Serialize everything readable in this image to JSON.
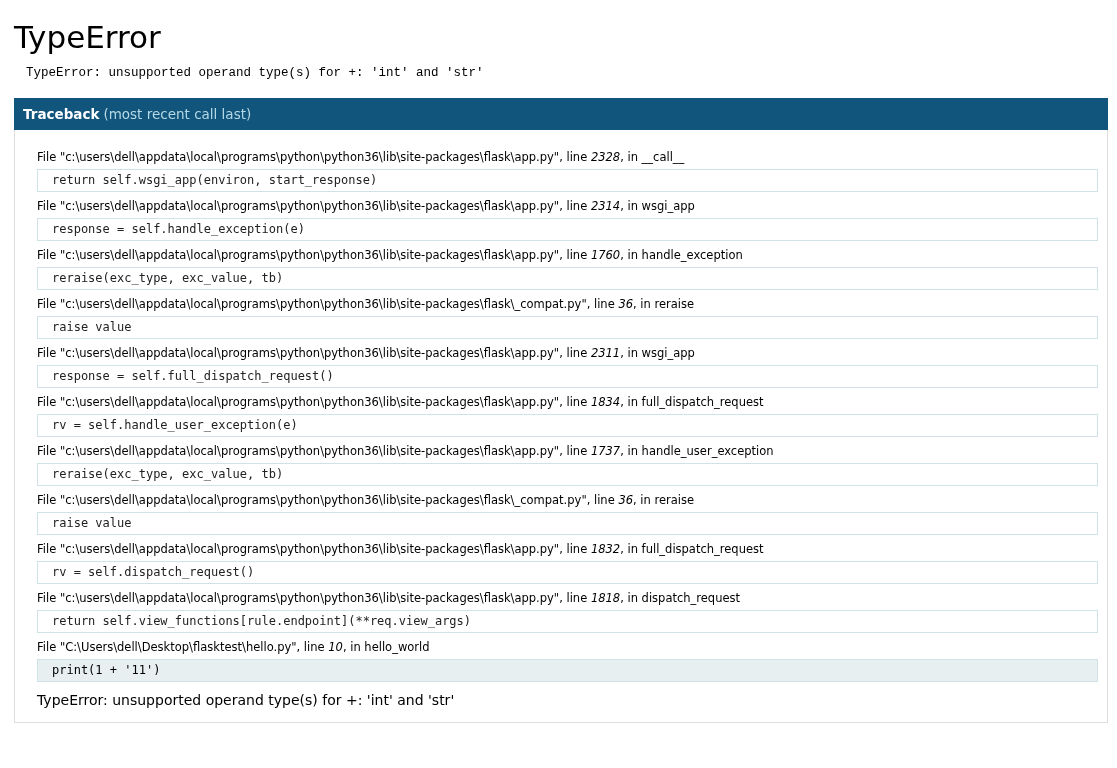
{
  "title": "TypeError",
  "error_summary": "TypeError: unsupported operand type(s) for +: 'int' and 'str'",
  "traceback": {
    "heading": "Traceback",
    "note": "(most recent call last)",
    "frames": [
      {
        "header": "File \"c:\\users\\dell\\appdata\\local\\programs\\python\\python36\\lib\\site-packages\\flask\\app.py\", line *2328*, in __call__",
        "code": "return self.wsgi_app(environ, start_response)",
        "current": false
      },
      {
        "header": "File \"c:\\users\\dell\\appdata\\local\\programs\\python\\python36\\lib\\site-packages\\flask\\app.py\", line *2314*, in wsgi_app",
        "code": "response = self.handle_exception(e)",
        "current": false
      },
      {
        "header": "File \"c:\\users\\dell\\appdata\\local\\programs\\python\\python36\\lib\\site-packages\\flask\\app.py\", line *1760*, in handle_exception",
        "code": "reraise(exc_type, exc_value, tb)",
        "current": false
      },
      {
        "header": "File \"c:\\users\\dell\\appdata\\local\\programs\\python\\python36\\lib\\site-packages\\flask\\_compat.py\", line *36*, in reraise",
        "code": "raise value",
        "current": false
      },
      {
        "header": "File \"c:\\users\\dell\\appdata\\local\\programs\\python\\python36\\lib\\site-packages\\flask\\app.py\", line *2311*, in wsgi_app",
        "code": "response = self.full_dispatch_request()",
        "current": false
      },
      {
        "header": "File \"c:\\users\\dell\\appdata\\local\\programs\\python\\python36\\lib\\site-packages\\flask\\app.py\", line *1834*, in full_dispatch_request",
        "code": "rv = self.handle_user_exception(e)",
        "current": false
      },
      {
        "header": "File \"c:\\users\\dell\\appdata\\local\\programs\\python\\python36\\lib\\site-packages\\flask\\app.py\", line *1737*, in handle_user_exception",
        "code": "reraise(exc_type, exc_value, tb)",
        "current": false
      },
      {
        "header": "File \"c:\\users\\dell\\appdata\\local\\programs\\python\\python36\\lib\\site-packages\\flask\\_compat.py\", line *36*, in reraise",
        "code": "raise value",
        "current": false
      },
      {
        "header": "File \"c:\\users\\dell\\appdata\\local\\programs\\python\\python36\\lib\\site-packages\\flask\\app.py\", line *1832*, in full_dispatch_request",
        "code": "rv = self.dispatch_request()",
        "current": false
      },
      {
        "header": "File \"c:\\users\\dell\\appdata\\local\\programs\\python\\python36\\lib\\site-packages\\flask\\app.py\", line *1818*, in dispatch_request",
        "code": "return self.view_functions[rule.endpoint](**req.view_args)",
        "current": false
      },
      {
        "header": "File \"C:\\Users\\dell\\Desktop\\flasktest\\hello.py\", line *10*, in hello_world",
        "code": "print(1 + '11')",
        "current": true
      }
    ],
    "exception": "TypeError: unsupported operand type(s) for +: 'int' and 'str'"
  }
}
